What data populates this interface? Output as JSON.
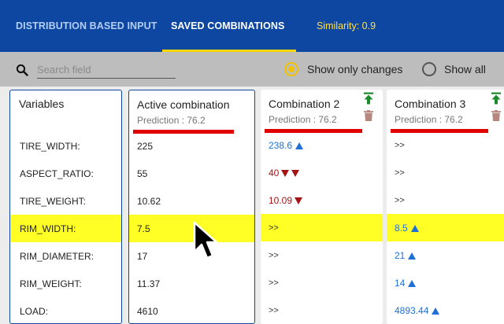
{
  "tabs": {
    "distribution": "DISTRIBUTION BASED INPUT",
    "saved": "SAVED COMBINATIONS",
    "similarity": "Similarity: 0.9"
  },
  "search": {
    "placeholder": "Search field",
    "value": ""
  },
  "options": {
    "show_only_changes": "Show only changes",
    "show_all": "Show all",
    "selected": "show_only_changes"
  },
  "variables": {
    "title": "Variables",
    "names": [
      "TIRE_WIDTH:",
      "ASPECT_RATIO:",
      "TIRE_WEIGHT:",
      "RIM_WIDTH:",
      "RIM_DIAMETER:",
      "RIM_WEIGHT:",
      "LOAD:"
    ]
  },
  "active": {
    "title": "Active combination",
    "prediction": "Prediction : 76.2",
    "values": [
      "225",
      "55",
      "10.62",
      "7.5",
      "17",
      "11.37",
      "4610"
    ]
  },
  "combo2": {
    "title": "Combination 2",
    "prediction": "Prediction : 76.2",
    "cells": [
      {
        "text": "238.6",
        "dir": "up",
        "arrows": 1
      },
      {
        "text": "40",
        "dir": "down",
        "arrows": 2
      },
      {
        "text": "10.09",
        "dir": "down",
        "arrows": 1
      },
      {
        "text": ">>",
        "dir": "same",
        "arrows": 0
      },
      {
        "text": ">>",
        "dir": "same",
        "arrows": 0
      },
      {
        "text": ">>",
        "dir": "same",
        "arrows": 0
      },
      {
        "text": ">>",
        "dir": "same",
        "arrows": 0
      }
    ]
  },
  "combo3": {
    "title": "Combination 3",
    "prediction": "Prediction : 76.2",
    "cells": [
      {
        "text": ">>",
        "dir": "same",
        "arrows": 0
      },
      {
        "text": ">>",
        "dir": "same",
        "arrows": 0
      },
      {
        "text": ">>",
        "dir": "same",
        "arrows": 0
      },
      {
        "text": "8.5",
        "dir": "up",
        "arrows": 1
      },
      {
        "text": "21",
        "dir": "up",
        "arrows": 1
      },
      {
        "text": "14",
        "dir": "up",
        "arrows": 1
      },
      {
        "text": "4893.44",
        "dir": "up",
        "arrows": 1
      }
    ]
  },
  "highlight_row": "RIM_WIDTH:",
  "colors": {
    "header": "#0d47a1",
    "accent": "#ffd600",
    "highlight": "#ffff26",
    "increase": "#1e70d6",
    "decrease": "#a31515",
    "prediction_marker": "#e00000",
    "pin": "#1b8a2a",
    "trash": "#b5877f"
  },
  "icons": [
    "search-icon",
    "pin-to-top-icon",
    "trash-icon",
    "mouse-pointer-icon"
  ]
}
